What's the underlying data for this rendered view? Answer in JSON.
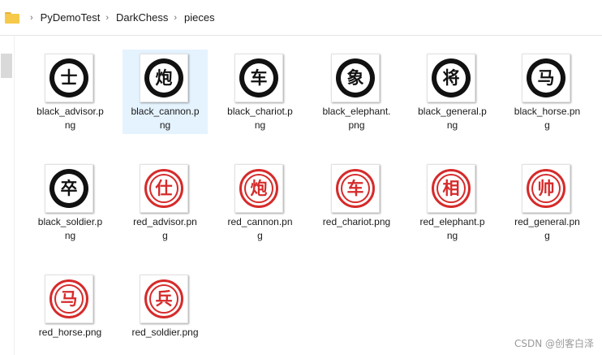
{
  "breadcrumb": {
    "items": [
      "PyDemoTest",
      "DarkChess",
      "pieces"
    ],
    "separator": "›",
    "folder_icon": "folder-icon"
  },
  "files": [
    {
      "name_line1": "black_advisor.p",
      "name_line2": "ng",
      "glyph": "士",
      "color": "black",
      "selected": false
    },
    {
      "name_line1": "black_cannon.p",
      "name_line2": "ng",
      "glyph": "炮",
      "color": "black",
      "selected": true
    },
    {
      "name_line1": "black_chariot.p",
      "name_line2": "ng",
      "glyph": "车",
      "color": "black",
      "selected": false
    },
    {
      "name_line1": "black_elephant.",
      "name_line2": "png",
      "glyph": "象",
      "color": "black",
      "selected": false
    },
    {
      "name_line1": "black_general.p",
      "name_line2": "ng",
      "glyph": "将",
      "color": "black",
      "selected": false
    },
    {
      "name_line1": "black_horse.pn",
      "name_line2": "g",
      "glyph": "马",
      "color": "black",
      "selected": false
    },
    {
      "name_line1": "black_soldier.p",
      "name_line2": "ng",
      "glyph": "卒",
      "color": "black",
      "selected": false
    },
    {
      "name_line1": "red_advisor.pn",
      "name_line2": "g",
      "glyph": "仕",
      "color": "red",
      "selected": false
    },
    {
      "name_line1": "red_cannon.pn",
      "name_line2": "g",
      "glyph": "炮",
      "color": "red",
      "selected": false
    },
    {
      "name_line1": "red_chariot.png",
      "name_line2": "",
      "glyph": "车",
      "color": "red",
      "selected": false
    },
    {
      "name_line1": "red_elephant.p",
      "name_line2": "ng",
      "glyph": "相",
      "color": "red",
      "selected": false
    },
    {
      "name_line1": "red_general.pn",
      "name_line2": "g",
      "glyph": "帅",
      "color": "red",
      "selected": false
    },
    {
      "name_line1": "red_horse.png",
      "name_line2": "",
      "glyph": "马",
      "color": "red",
      "selected": false
    },
    {
      "name_line1": "red_soldier.png",
      "name_line2": "",
      "glyph": "兵",
      "color": "red",
      "selected": false
    }
  ],
  "watermark": "CSDN @创客白泽",
  "colors": {
    "selection": "#e5f3ff",
    "red_piece": "#d62b2b",
    "black_piece": "#111111"
  }
}
